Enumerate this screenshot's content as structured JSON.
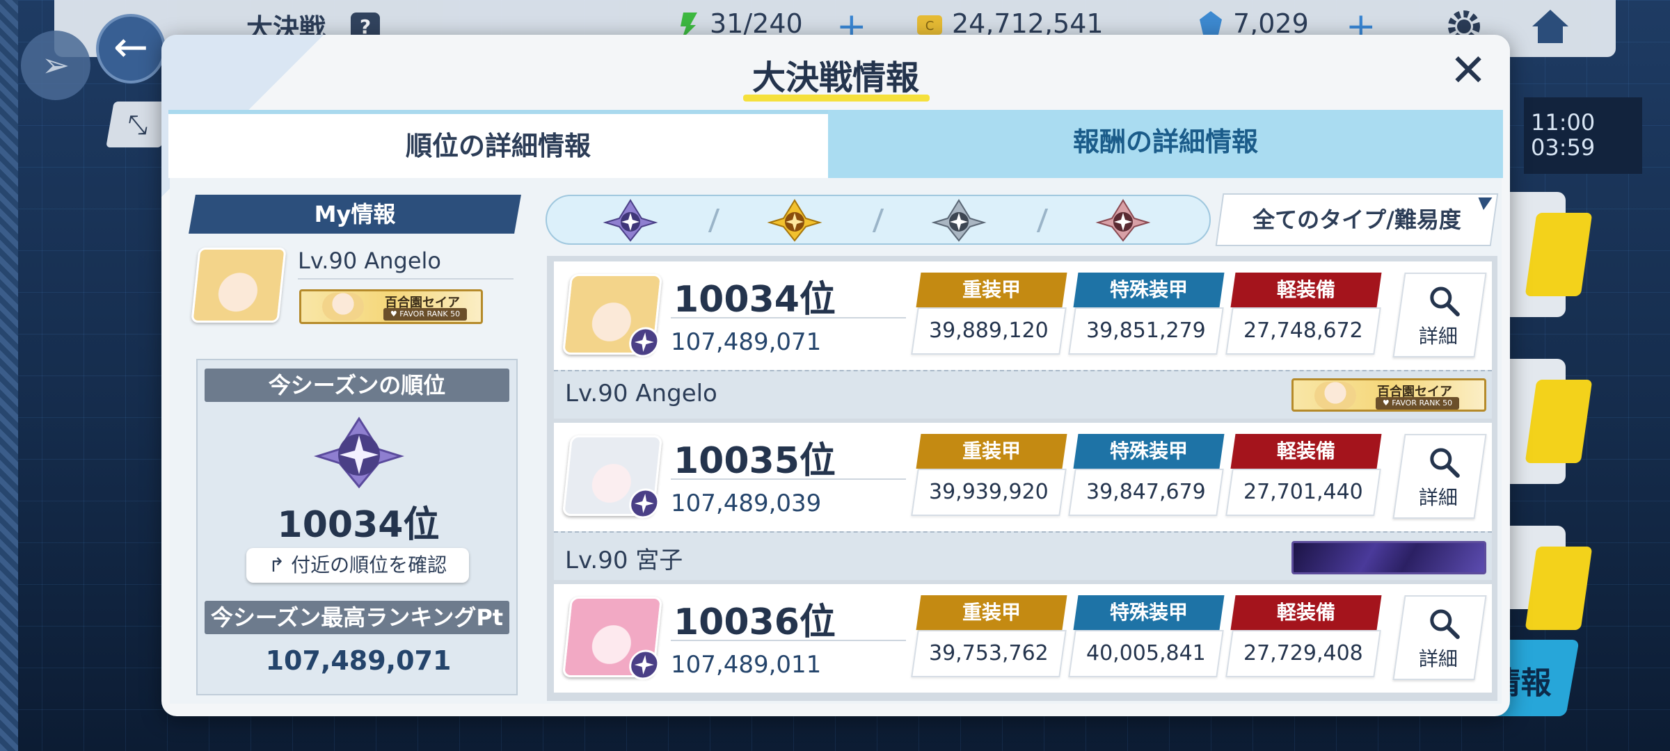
{
  "hud": {
    "title": "大決戦",
    "help_icon": "?",
    "ap": "31/240",
    "credits": "24,712,541",
    "pyroxene": "7,029",
    "plus_label": "+"
  },
  "side": {
    "time1": "11:00",
    "time2": "03:59",
    "bottom_button_label": "情報"
  },
  "modal": {
    "title": "大決戦情報",
    "close_label": "✕",
    "tabs": [
      "順位の詳細情報",
      "報酬の詳細情報"
    ]
  },
  "my_info": {
    "header": "My情報",
    "level_name": "Lv.90 Angelo",
    "favor_student": "百合園セイア",
    "favor_rank": "♥ FAVOR RANK 50",
    "season_rank_label": "今シーズンの順位",
    "season_rank": "10034位",
    "nearby_button": "↱ 付近の順位を確認",
    "best_pt_label": "今シーズン最高ランキングPt",
    "best_pt": "107,489,071"
  },
  "filter": {
    "type_dropdown": "全てのタイプ/難易度",
    "separator": "/",
    "tier_icons": [
      "tier-platinum-icon",
      "tier-gold-icon",
      "tier-silver-icon",
      "tier-bronze-icon"
    ],
    "tier_colors": [
      "#7c6ac0",
      "#e3a91c",
      "#6c7a88",
      "#b0606a"
    ]
  },
  "categories": {
    "heavy": "重装甲",
    "special": "特殊装甲",
    "light": "軽装備",
    "heavy_color": "#c48a12",
    "special_color": "#1e73a6",
    "light_color": "#a4141c",
    "detail_label": "詳細"
  },
  "entries": [
    {
      "rank": "10034位",
      "score": "107,489,071",
      "heavy": "39,889,120",
      "special": "39,851,279",
      "light": "27,748,672",
      "name": "Lv.90  Angelo",
      "favor_student": "百合園セイア",
      "favor_rank": "♥ FAVOR RANK 50",
      "avatar_hair": "#f3d48a"
    },
    {
      "rank": "10035位",
      "score": "107,489,039",
      "heavy": "39,939,920",
      "special": "39,847,679",
      "light": "27,701,440",
      "name": "Lv.90  宮子",
      "avatar_hair": "#e8ecf2"
    },
    {
      "rank": "10036位",
      "score": "107,489,011",
      "heavy": "39,753,762",
      "special": "40,005,841",
      "light": "27,729,408",
      "name": "",
      "avatar_hair": "#f2a9c4"
    }
  ]
}
